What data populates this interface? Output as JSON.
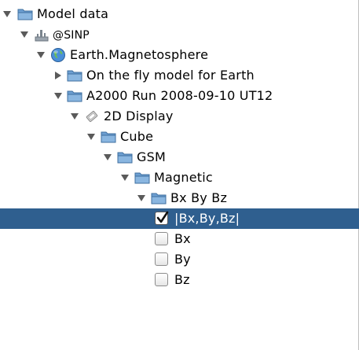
{
  "tree": {
    "root": {
      "label": "Model data"
    },
    "sinp": {
      "label": "@SINP"
    },
    "earth": {
      "label": "Earth.Magnetosphere"
    },
    "on_the_fly": {
      "label": "On the fly model for Earth"
    },
    "run": {
      "label": "A2000 Run 2008-09-10 UT12"
    },
    "display": {
      "label": "2D Display"
    },
    "cube": {
      "label": "Cube"
    },
    "gsm": {
      "label": "GSM"
    },
    "magnetic": {
      "label": "Magnetic"
    },
    "bxbybz": {
      "label": "Bx By Bz"
    },
    "leaves": [
      {
        "label": "|Bx,By,Bz|",
        "checked": true
      },
      {
        "label": "Bx",
        "checked": false
      },
      {
        "label": "By",
        "checked": false
      },
      {
        "label": "Bz",
        "checked": false
      }
    ]
  },
  "colors": {
    "selection": "#2f5f8f",
    "folder": "#5b8fc4",
    "arrow": "#5a5a5a"
  },
  "icons": {
    "folder": "folder-icon",
    "server": "server-icon",
    "globe": "globe-icon",
    "display": "display-icon",
    "expanded": "triangle-down-icon",
    "collapsed": "triangle-right-icon"
  }
}
